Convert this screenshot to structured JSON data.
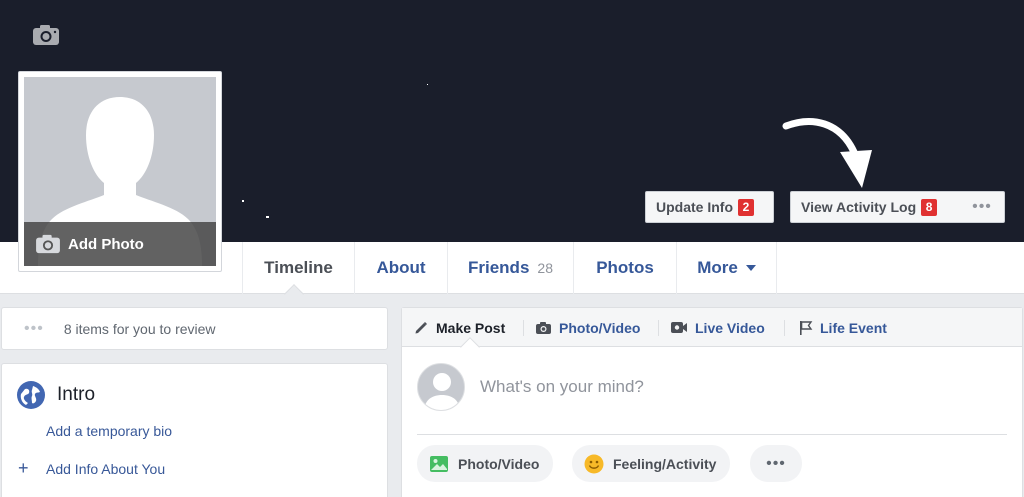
{
  "cover": {
    "add_photo_label": "Add Photo",
    "update_info_label": "Update Info",
    "update_info_count": "2",
    "activity_log_label": "View Activity Log",
    "activity_log_count": "8",
    "more_label": "•••"
  },
  "nav": {
    "tabs": [
      {
        "label": "Timeline"
      },
      {
        "label": "About"
      },
      {
        "label": "Friends",
        "count": "28"
      },
      {
        "label": "Photos"
      },
      {
        "label": "More"
      }
    ]
  },
  "review": {
    "dots": "•••",
    "text": "8 items for you to review"
  },
  "intro": {
    "title": "Intro",
    "bio_link": "Add a temporary bio",
    "add_info_plus": "+",
    "add_info": "Add Info About You"
  },
  "composer": {
    "actions": [
      {
        "label": "Make Post",
        "icon": "pencil-icon"
      },
      {
        "label": "Photo/Video",
        "icon": "camera-icon"
      },
      {
        "label": "Live Video",
        "icon": "video-icon"
      },
      {
        "label": "Life Event",
        "icon": "flag-icon"
      }
    ],
    "placeholder": "What's on your mind?",
    "buttons": [
      {
        "label": "Photo/Video",
        "icon": "image-icon"
      },
      {
        "label": "Feeling/Activity",
        "icon": "smiley-icon"
      }
    ],
    "more_label": "•••"
  },
  "colors": {
    "cover_bg": "#1a1e2b",
    "link_blue": "#365899",
    "badge_red": "#e03131",
    "page_bg": "#e9ebee"
  }
}
